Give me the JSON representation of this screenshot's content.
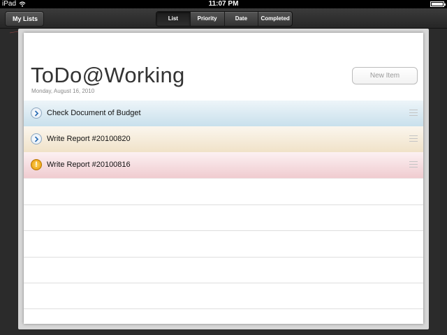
{
  "status_bar": {
    "device": "iPad",
    "time": "11:07 PM"
  },
  "nav": {
    "back_label": "My Lists",
    "tabs": [
      {
        "label": "List",
        "selected": true
      },
      {
        "label": "Priority",
        "selected": false
      },
      {
        "label": "Date",
        "selected": false
      },
      {
        "label": "Completed",
        "selected": false
      }
    ]
  },
  "list": {
    "title": "ToDo@Working",
    "date": "Monday, August 16, 2010",
    "new_item_label": "New Item",
    "items": [
      {
        "label": "Check Document of Budget",
        "icon": "chevron-right-icon",
        "color": "#c9e0ec"
      },
      {
        "label": "Write Report #20100820",
        "icon": "chevron-right-icon",
        "color": "#f0e2c8"
      },
      {
        "label": "Write Report #20100816",
        "icon": "exclamation-icon",
        "color": "#f0ccd0"
      }
    ]
  },
  "colors": {
    "accent": "#2f6fb5",
    "warning": "#e59500"
  }
}
